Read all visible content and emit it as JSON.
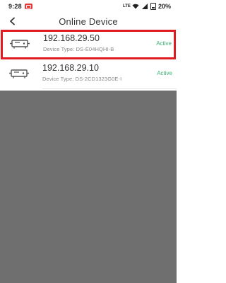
{
  "status_bar": {
    "time": "9:28",
    "network_text": "LTE",
    "battery": "20%"
  },
  "header": {
    "title": "Online Device",
    "back_icon": "chevron-left-icon"
  },
  "devices": [
    {
      "ip": "192.168.29.50",
      "type": "Device Type: DS-E04HQHI-B",
      "status": "Active",
      "selected": true
    },
    {
      "ip": "192.168.29.10",
      "type": "Device Type: DS-2CD1323G0E-I",
      "status": "Active",
      "selected": false
    }
  ],
  "colors": {
    "highlight": "#e11b22",
    "active": "#3bb273",
    "overlay": "#6f6f6f"
  }
}
